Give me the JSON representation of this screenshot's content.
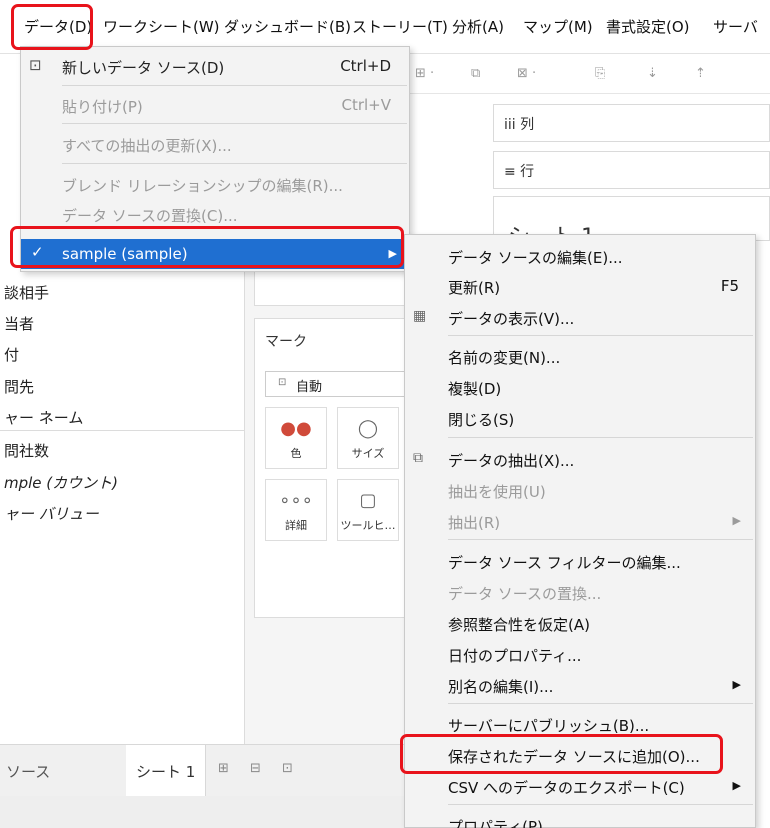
{
  "menubar": {
    "items": [
      "データ(D)",
      "ワークシート(W)",
      "ダッシュボード(B)",
      "ストーリー(T)",
      "分析(A)",
      "マップ(M)",
      "書式設定(O)",
      "サーバ"
    ]
  },
  "shelves": {
    "columns": "iii 列",
    "rows": "≡ 行"
  },
  "sheet_title": "シート 1",
  "fields": [
    "談相手",
    "当者",
    "付",
    "問先",
    "ャー ネーム",
    "問社数",
    "mple (カウント)",
    "ャー バリュー"
  ],
  "marks": {
    "title": "マーク",
    "type": "自動",
    "buttons": [
      {
        "icon": "●●",
        "label": "色"
      },
      {
        "icon": "◯",
        "label": "サイズ"
      },
      {
        "icon": "∘∘∘",
        "label": "詳細"
      },
      {
        "icon": "▢",
        "label": "ツールヒ…"
      }
    ]
  },
  "bottom": {
    "data_source_label": "ソース",
    "sheet_tab": "シート 1"
  },
  "data_menu": {
    "items": [
      {
        "label": "新しいデータ ソース(D)",
        "shortcut": "Ctrl+D",
        "enabled": true
      },
      {
        "label": "貼り付け(P)",
        "shortcut": "Ctrl+V",
        "enabled": false
      },
      {
        "label": "すべての抽出の更新(X)...",
        "shortcut": "",
        "enabled": false
      },
      {
        "label": "ブレンド リレーションシップの編集(R)...",
        "shortcut": "",
        "enabled": false
      },
      {
        "label": "データ ソースの置換(C)...",
        "shortcut": "",
        "enabled": false
      },
      {
        "label": "sample (sample)",
        "shortcut": "",
        "enabled": true
      }
    ]
  },
  "datasource_submenu": {
    "items": [
      {
        "label": "データ ソースの編集(E)...",
        "shortcut": "",
        "enabled": true
      },
      {
        "label": "更新(R)",
        "shortcut": "F5",
        "enabled": true
      },
      {
        "label": "データの表示(V)...",
        "shortcut": "",
        "enabled": true
      },
      {
        "label": "名前の変更(N)...",
        "shortcut": "",
        "enabled": true
      },
      {
        "label": "複製(D)",
        "shortcut": "",
        "enabled": true
      },
      {
        "label": "閉じる(S)",
        "shortcut": "",
        "enabled": true
      },
      {
        "label": "データの抽出(X)...",
        "shortcut": "",
        "enabled": true
      },
      {
        "label": "抽出を使用(U)",
        "shortcut": "",
        "enabled": false
      },
      {
        "label": "抽出(R)",
        "shortcut": "",
        "enabled": false
      },
      {
        "label": "データ ソース フィルターの編集...",
        "shortcut": "",
        "enabled": true
      },
      {
        "label": "データ ソースの置換...",
        "shortcut": "",
        "enabled": false
      },
      {
        "label": "参照整合性を仮定(A)",
        "shortcut": "",
        "enabled": true
      },
      {
        "label": "日付のプロパティ...",
        "shortcut": "",
        "enabled": true
      },
      {
        "label": "別名の編集(I)...",
        "shortcut": "",
        "enabled": true
      },
      {
        "label": "サーバーにパブリッシュ(B)...",
        "shortcut": "",
        "enabled": true
      },
      {
        "label": "保存されたデータ ソースに追加(O)...",
        "shortcut": "",
        "enabled": true
      },
      {
        "label": "CSV へのデータのエクスポート(C)",
        "shortcut": "",
        "enabled": true
      },
      {
        "label": "プロパティ(P)",
        "shortcut": "",
        "enabled": true
      }
    ]
  },
  "colors": {
    "highlight_red": "#e8131b",
    "selection_blue": "#1f6fd1",
    "menu_bg": "#f3f3f3"
  }
}
